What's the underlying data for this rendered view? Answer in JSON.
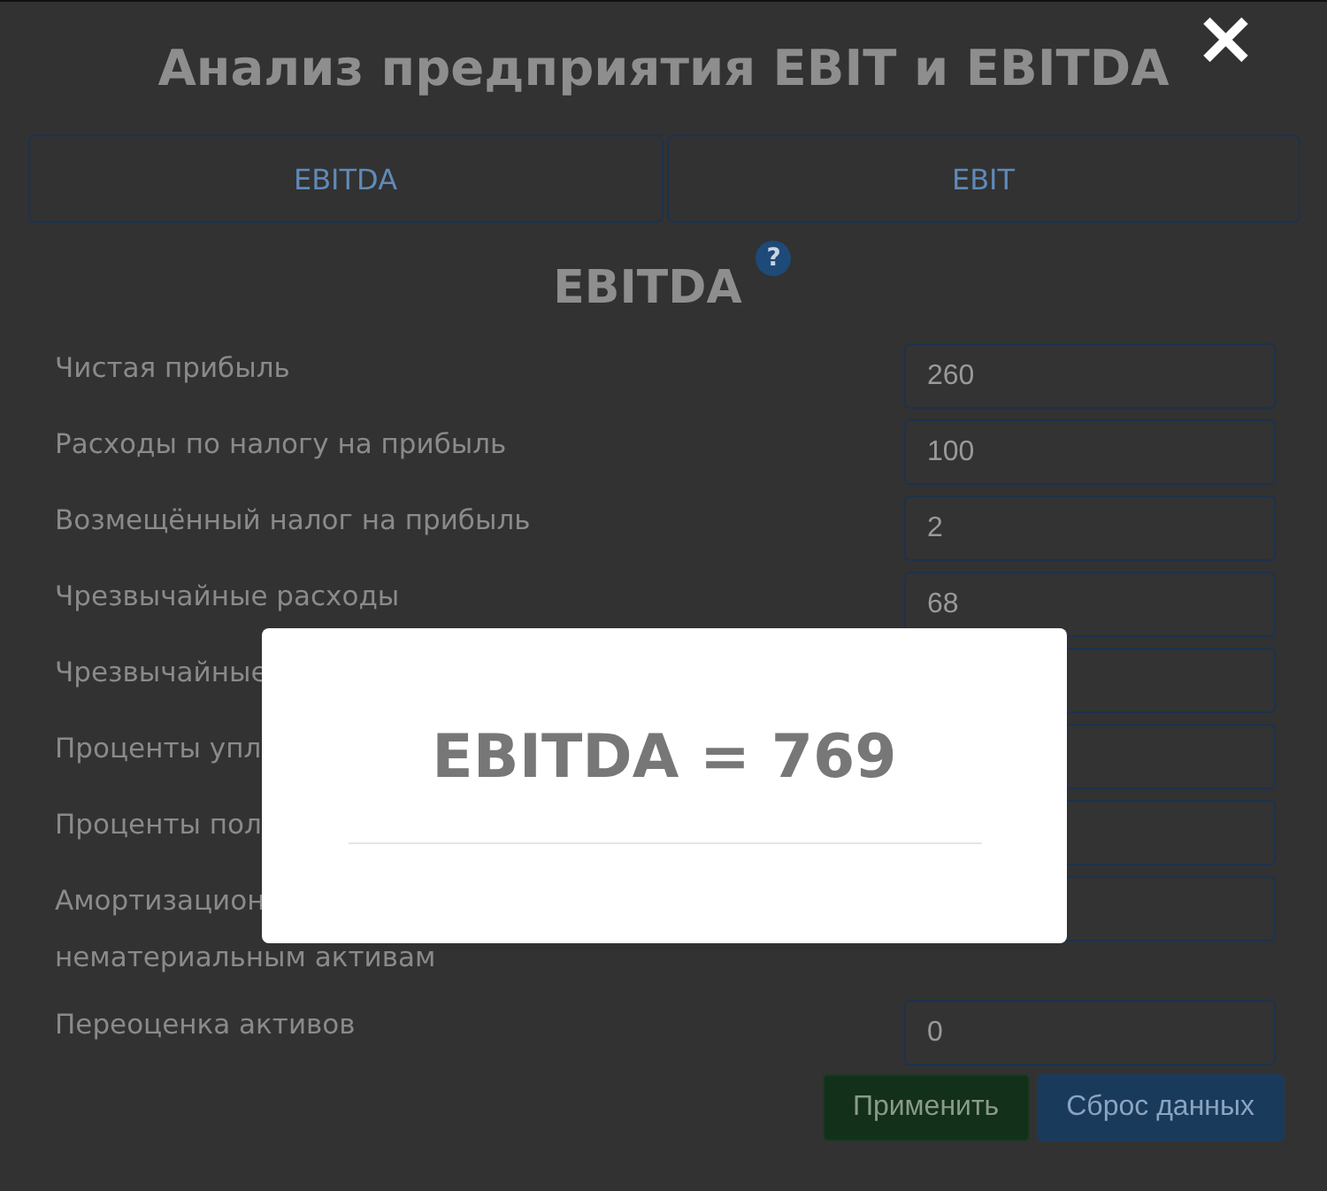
{
  "title": "Анализ предприятия EBIT и EBITDA",
  "close": "✕",
  "tabs": [
    "EBITDA",
    "EBIT"
  ],
  "section": {
    "heading": "EBITDA",
    "help": "?"
  },
  "rows": [
    {
      "label": "Чистая прибыль",
      "value": "260"
    },
    {
      "label": "Расходы по налогу на прибыль",
      "value": "100"
    },
    {
      "label": "Возмещённый налог на прибыль",
      "value": "2"
    },
    {
      "label": "Чрезвычайные расходы",
      "value": "68"
    },
    {
      "label": "Чрезвычайные"
    },
    {
      "label": "Проценты упл"
    },
    {
      "label": "Проценты пол"
    },
    {
      "label": "Амортизацион",
      "continuation": "нематериальным активам"
    },
    {
      "label": "Переоценка активов",
      "value": "0"
    }
  ],
  "buttons": [
    {
      "label": "Применить",
      "kind": "apply"
    },
    {
      "label": "Сброс данных",
      "kind": "reset"
    }
  ],
  "result": {
    "text": "EBITDA = 769"
  }
}
